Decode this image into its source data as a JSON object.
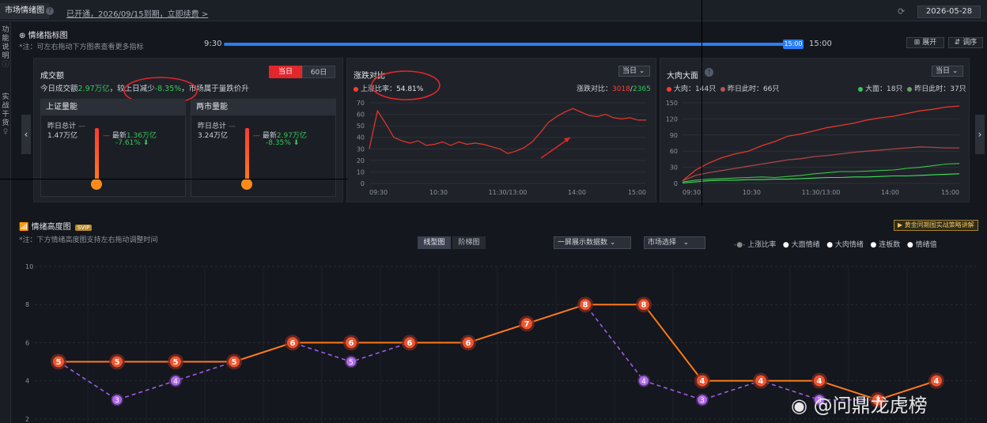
{
  "topbar": {
    "tab_title": "市场情绪图",
    "info": "?",
    "renew_text": "已开通，2026/09/15到期，立即续费 >",
    "date": "2026-05-28"
  },
  "sidebar": {
    "items": [
      "功",
      "能",
      "说",
      "明",
      "实",
      "战",
      "干",
      "货"
    ]
  },
  "indicator": {
    "title": "情绪指标图",
    "note": "*注：可左右拖动下方图表查看更多指标",
    "time_start": "9:30",
    "time_end": "15:00",
    "time_current": "15:00",
    "expand": "展开",
    "settings": "调序"
  },
  "panel1": {
    "title": "成交额",
    "tab_today": "当日",
    "tab_60": "60日",
    "summary_prefix": "今日成交额",
    "summary_amount": "2.97万亿",
    "summary_mid": "，较上日减少",
    "summary_pct": "-8.35%",
    "summary_suffix": "，市场属于量跌价升",
    "sh": {
      "title": "上证量能",
      "prev_label": "昨日总计",
      "prev_value": "1.47万亿",
      "latest_label": "最新",
      "latest_value": "1.36万亿",
      "latest_pct": "-7.61%"
    },
    "two": {
      "title": "两市量能",
      "prev_label": "昨日总计",
      "prev_value": "3.24万亿",
      "latest_label": "最新",
      "latest_value": "2.97万亿",
      "latest_pct": "-8.35%"
    }
  },
  "panel2": {
    "title": "涨跌对比",
    "dropdown": "当日",
    "legend": "上涨比率：",
    "ratio": "54.81%",
    "cmp_label": "涨跌对比：",
    "up": "3018",
    "sep": "/",
    "down": "2365",
    "yticks": [
      "70",
      "60",
      "50",
      "40",
      "30",
      "20",
      "10",
      "0"
    ],
    "xticks": [
      "09:30",
      "10:30",
      "11:30/13:00",
      "14:00",
      "15:00"
    ]
  },
  "panel3": {
    "title": "大肉大面",
    "dropdown": "当日",
    "l1": "大肉：",
    "v1": "144只",
    "l2": "昨日此时：",
    "v2": "66只",
    "l3": "大面：",
    "v3": "18只",
    "l4": "昨日此时：",
    "v4": "37只",
    "yticks": [
      "150",
      "120",
      "90",
      "60",
      "30",
      "0"
    ],
    "xticks": [
      "09:30",
      "10:30",
      "11:30/13:00",
      "14:00",
      "15:00"
    ]
  },
  "height": {
    "title": "情绪高度图",
    "badge": "SVIP",
    "note": "*注：下方情绪高度图支持左右拖动调整时间",
    "tab_line": "线型图",
    "tab_step": "阶梯图",
    "dd1": "一屏展示数据数",
    "dd2": "市场选择",
    "promo": "黄金同期图实战策略讲解",
    "legend": [
      "上涨比率",
      "大面情绪",
      "大肉情绪",
      "连板数",
      "情绪值"
    ],
    "yticks": [
      "10",
      "8",
      "6",
      "4",
      "2"
    ]
  },
  "chart_data": [
    {
      "type": "line",
      "title": "涨跌对比",
      "series": [
        {
          "name": "上涨比率",
          "values": [
            30,
            63,
            52,
            40,
            37,
            35,
            37,
            33,
            34,
            36,
            33,
            36,
            34,
            35,
            34,
            32,
            30,
            26,
            28,
            31,
            36,
            44,
            53,
            58,
            62,
            65,
            62,
            59,
            58,
            60,
            57,
            56,
            57,
            55,
            55
          ]
        }
      ],
      "ylim": [
        0,
        70
      ]
    },
    {
      "type": "line",
      "title": "大肉大面",
      "series": [
        {
          "name": "大肉",
          "values": [
            5,
            25,
            38,
            48,
            55,
            60,
            70,
            78,
            88,
            92,
            98,
            104,
            108,
            112,
            118,
            122,
            125,
            130,
            135,
            138,
            142,
            144
          ]
        },
        {
          "name": "昨日此时",
          "values": [
            5,
            15,
            20,
            24,
            28,
            32,
            36,
            40,
            44,
            46,
            50,
            52,
            55,
            58,
            60,
            62,
            64,
            66,
            68,
            67,
            66,
            66
          ]
        },
        {
          "name": "大面",
          "values": [
            3,
            6,
            8,
            9,
            10,
            11,
            12,
            11,
            13,
            15,
            18,
            20,
            22,
            22,
            23,
            24,
            25,
            28,
            30,
            33,
            36,
            37
          ]
        },
        {
          "name": "昨日此时",
          "values": [
            1,
            3,
            5,
            6,
            6,
            7,
            7,
            8,
            8,
            9,
            10,
            11,
            11,
            12,
            12,
            13,
            14,
            14,
            15,
            16,
            17,
            18
          ]
        }
      ],
      "ylim": [
        0,
        150
      ]
    },
    {
      "type": "line",
      "title": "情绪高度图",
      "series": [
        {
          "name": "连板数",
          "values": [
            5,
            5,
            5,
            5,
            6,
            6,
            6,
            6,
            7,
            8,
            8,
            4,
            4,
            4,
            3,
            4
          ]
        },
        {
          "name": "情绪值",
          "values": [
            5,
            3,
            4,
            5,
            null,
            5,
            null,
            null,
            null,
            8,
            4,
            3,
            4,
            3,
            3,
            null
          ]
        }
      ],
      "ylim": [
        0,
        10
      ]
    }
  ]
}
